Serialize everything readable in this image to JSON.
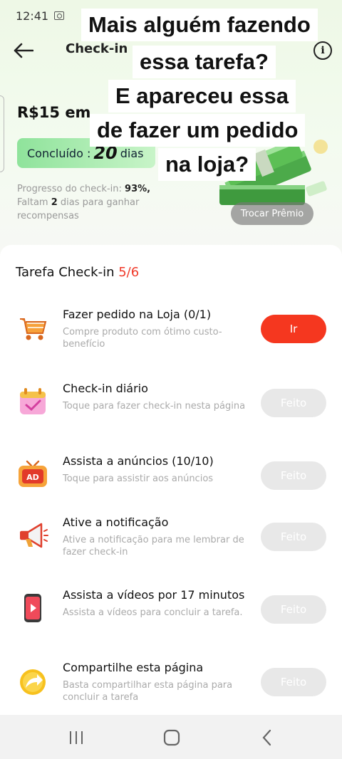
{
  "status_bar": {
    "time": "12:41"
  },
  "header": {
    "title": "Check-in p"
  },
  "reward": {
    "amount_label": "R$15 em",
    "done_label": "Concluído :",
    "days_count": "20",
    "days_suffix": "dias",
    "progress_prefix": "Progresso do check-in:",
    "progress_percent": "93%,",
    "progress_line2_a": "Faltam",
    "progress_remaining": "2",
    "progress_line2_b": "dias para ganhar",
    "progress_line3": "recompensas",
    "trade_button": "Trocar Prêmio"
  },
  "caption": {
    "line1": "Mais alguém fazendo",
    "line2": "essa tarefa?",
    "line3": "E apareceu essa",
    "line4": "de fazer um pedido",
    "line5": "na loja?"
  },
  "tasks": {
    "title": "Tarefa Check-in",
    "count": "5/6",
    "items": [
      {
        "title": "Fazer pedido na Loja  (0/1)",
        "desc": "Compre produto com ótimo custo-benefício",
        "button": "Ir",
        "icon": "cart-icon",
        "state": "pending"
      },
      {
        "title": "Check-in diário",
        "desc": "Toque para fazer check-in nesta página",
        "button": "Feito",
        "icon": "calendar-icon",
        "state": "done"
      },
      {
        "title": "Assista a anúncios  (10/10)",
        "desc": "Toque para assistir aos anúncios",
        "button": "Feito",
        "icon": "ad-tv-icon",
        "state": "done"
      },
      {
        "title": "Ative a notificação",
        "desc": "Ative a notificação para me lembrar de fazer check-in",
        "button": "Feito",
        "icon": "megaphone-icon",
        "state": "done"
      },
      {
        "title": "Assista a vídeos por 17 minutos",
        "desc": "Assista a vídeos para concluir a tarefa.",
        "button": "Feito",
        "icon": "video-phone-icon",
        "state": "done"
      },
      {
        "title": "Compartilhe esta página",
        "desc": "Basta compartilhar esta página para concluir a tarefa",
        "button": "Feito",
        "icon": "share-icon",
        "state": "done"
      }
    ]
  },
  "colors": {
    "accent": "#f5371f",
    "done_button": "#e8e8e8",
    "pill_green": "#8fe39b"
  }
}
